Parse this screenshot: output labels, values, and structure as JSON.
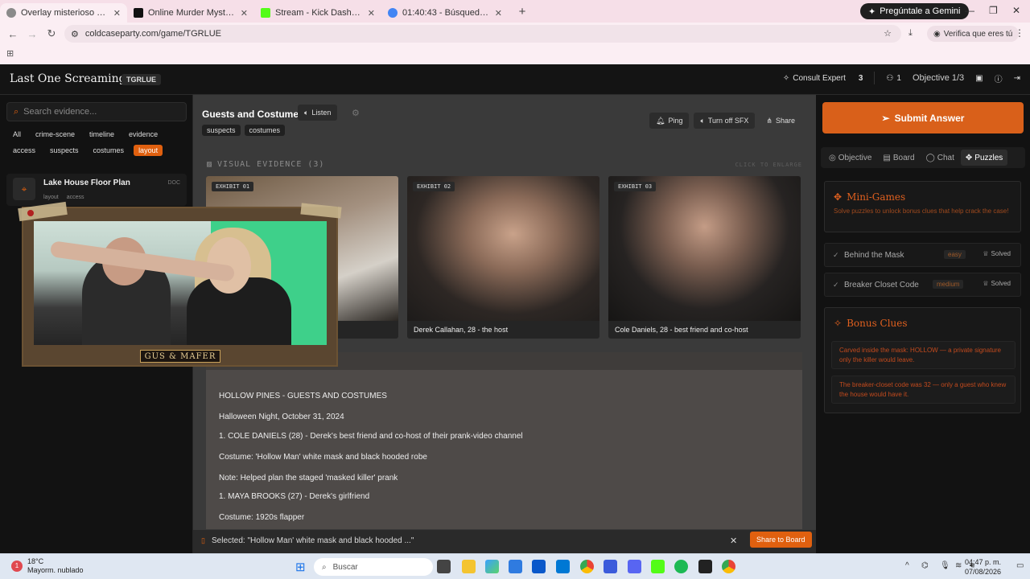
{
  "browser": {
    "tabs": [
      {
        "title": "Overlay misterioso para stream",
        "color": "#5f6368"
      },
      {
        "title": "Online Murder Mystery Game fo",
        "color": "#111111"
      },
      {
        "title": "Stream - Kick Dashboard",
        "color": "#53fc18"
      },
      {
        "title": "01:40:43 - Búsqueda de Google",
        "color": "#4285f4"
      }
    ],
    "gemini_label": "Pregúntale a Gemini",
    "url": "coldcaseparty.com/game/TGRLUE",
    "verify_label": "Verifica que eres tú"
  },
  "header": {
    "title": "Last One Screaming",
    "code": "TGRLUE",
    "consult_label": "Consult Expert",
    "consult_count": "3",
    "players_count": "1",
    "objective_label": "Objective 1/3"
  },
  "sidebar": {
    "search_placeholder": "Search evidence...",
    "filters": [
      "All",
      "crime-scene",
      "timeline",
      "evidence",
      "access",
      "suspects",
      "costumes",
      "layout"
    ],
    "active_filter": "layout",
    "evidence": {
      "title": "Lake House Floor Plan",
      "type": "DOC",
      "tags": [
        "layout",
        "access"
      ]
    }
  },
  "main": {
    "title": "Guests and Costumes",
    "listen_label": "Listen",
    "tags": [
      "suspects",
      "costumes"
    ],
    "actions": {
      "ping": "Ping",
      "sfx": "Turn off SFX",
      "share": "Share"
    },
    "visual_header": "VISUAL EVIDENCE (3)",
    "click_enlarge": "CLICK TO ENLARGE",
    "exhibits": [
      {
        "badge": "EXHIBIT 01",
        "caption": ""
      },
      {
        "badge": "EXHIBIT 02",
        "caption": "Derek Callahan, 28 - the host"
      },
      {
        "badge": "EXHIBIT 03",
        "caption": "Cole Daniels, 28 - best friend and co-host"
      }
    ],
    "document_lines": [
      "HOLLOW PINES - GUESTS AND COSTUMES",
      "Halloween Night, October 31, 2024",
      "1. COLE DANIELS (28) - Derek's best friend and co-host of their prank-video channel",
      "Costume: 'Hollow Man' white mask and black hooded robe",
      "Note: Helped plan the staged 'masked killer' prank",
      "1. MAYA BROOKS (27) - Derek's girlfriend",
      "Costume: 1920s flapper"
    ],
    "selection": {
      "text": "Selected: \"Hollow Man' white mask and black hooded ...\"",
      "share_label": "Share to Board"
    }
  },
  "overlay": {
    "name": "GUS & MAFER"
  },
  "right_panel": {
    "submit_label": "Submit Answer",
    "tabs": [
      "Objective",
      "Board",
      "Chat",
      "Puzzles"
    ],
    "active_tab": "Puzzles",
    "minigames": {
      "title": "Mini-Games",
      "subtitle": "Solve puzzles to unlock bonus clues that help crack the case!",
      "games": [
        {
          "name": "Behind the Mask",
          "level": "easy",
          "status": "Solved"
        },
        {
          "name": "Breaker Closet Code",
          "level": "medium",
          "status": "Solved"
        }
      ]
    },
    "bonus": {
      "title": "Bonus Clues",
      "clues": [
        "Carved inside the mask: HOLLOW — a private signature only the killer would leave.",
        "The breaker-closet code was 32 — only a guest who knew the house would have it."
      ]
    }
  },
  "taskbar": {
    "temp": "18°C",
    "weather": "Mayorm. nublado",
    "search_label": "Buscar",
    "time": "04:47 p. m.",
    "date": "07/08/2026"
  },
  "colors": {
    "accent": "#e0600f"
  }
}
